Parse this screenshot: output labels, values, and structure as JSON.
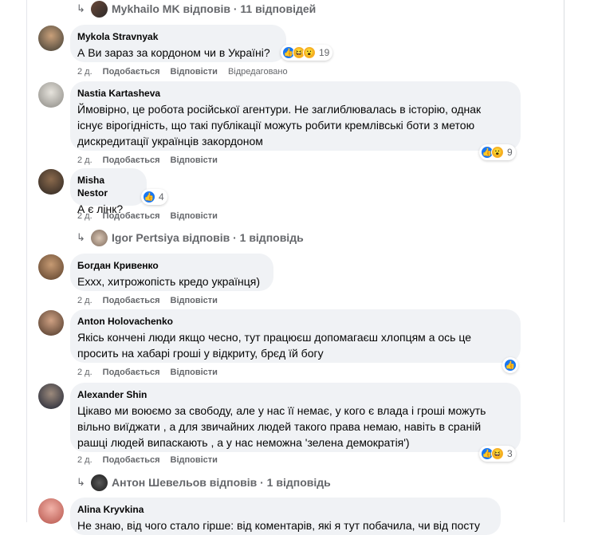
{
  "reply_links": [
    {
      "text": "Mykhailo MK відповів · 11 відповідей"
    },
    {
      "text": "Igor Pertsiya відповів · 1 відповідь"
    },
    {
      "text": "Антон Шевельов відповів · 1 відповідь"
    }
  ],
  "comments": [
    {
      "author": "Mykola Stravnyak",
      "lines": [
        "А Ви зараз за кордоном чи в Україні?"
      ],
      "reaction_count": "19",
      "reactions": [
        "like-icon",
        "haha-icon",
        "wow-icon"
      ],
      "time": "2 д.",
      "like_label": "Подобається",
      "reply_label": "Відповісти",
      "edited": "Відредаговано"
    },
    {
      "author": "Nastia Kartasheva",
      "lines": [
        "Ймовірно, це робота російської агентури. Не заглиблювалась в історію, однак",
        "існує вірогідність, що такі публікації можуть робити кремлівські боти з метою",
        "дискредитації українців закордоном"
      ],
      "reaction_count": "9",
      "reactions": [
        "like-icon",
        "wow-icon"
      ],
      "time": "2 д.",
      "like_label": "Подобається",
      "reply_label": "Відповісти"
    },
    {
      "author": "Misha Nestor",
      "lines": [
        "А є лінк?"
      ],
      "reaction_count": "4",
      "reactions": [
        "like-icon"
      ],
      "time": "2 д.",
      "like_label": "Подобається",
      "reply_label": "Відповісти"
    },
    {
      "author": "Богдан Кривенко",
      "lines": [
        "Еххх, хитрожопість кредо українця)"
      ],
      "time": "2 д.",
      "like_label": "Подобається",
      "reply_label": "Відповісти"
    },
    {
      "author": "Anton Holovachenko",
      "lines": [
        "Якісь кончені люди якщо чесно, тут працюєш допомагаєш хлопцям а ось це",
        "просить на хабарі гроші у відкриту, брєд їй богу"
      ],
      "reactions": [
        "like-icon"
      ],
      "time": "2 д.",
      "like_label": "Подобається",
      "reply_label": "Відповісти"
    },
    {
      "author": "Alexander Shin",
      "lines": [
        "Цікаво ми воюємо за свободу, але у нас її немає, у кого є влада і гроші можуть",
        "вільно виїджати , а для звичайних людей такого права немаю, навіть в сраній",
        "рашці людей випаскають , а у нас неможна 'зелена демократія')"
      ],
      "reaction_count": "3",
      "reactions": [
        "like-icon",
        "haha-icon"
      ],
      "time": "2 д.",
      "like_label": "Подобається",
      "reply_label": "Відповісти"
    },
    {
      "author": "Alina Kryvkina",
      "lines": [
        "Не знаю, від чого стало гірше: від коментарів, які я тут побачила, чи від посту"
      ]
    }
  ],
  "colors": {
    "bubble": "#f0f2f5",
    "like": "#1877f2",
    "muted": "#65676b",
    "text": "#050505"
  }
}
